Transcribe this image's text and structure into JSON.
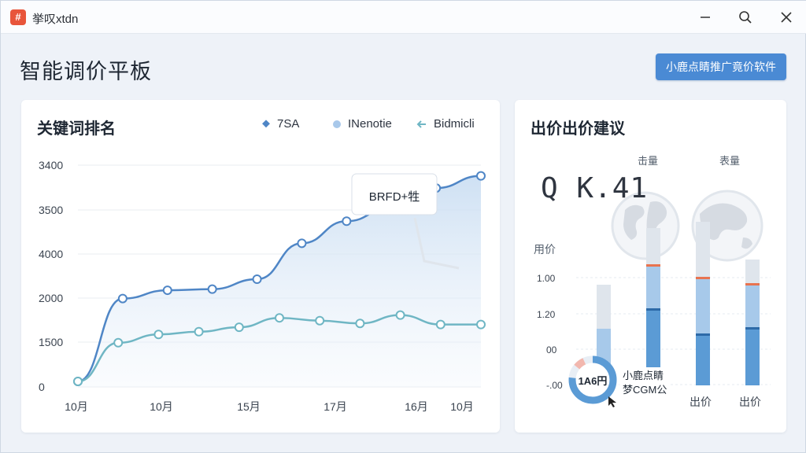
{
  "window": {
    "app_name": "挙叹xtdn",
    "app_icon_glyph": "#"
  },
  "header": {
    "title": "智能调价平板",
    "cta_label": "小鹿点睛推广竟价软件"
  },
  "left_card": {
    "title": "关键词排名",
    "legend": [
      {
        "label": "7SA",
        "color": "#4f86c6",
        "marker": "diamond"
      },
      {
        "label": "INenotie",
        "color": "#a8c8ea",
        "marker": "dot"
      },
      {
        "label": "Bidmicli",
        "color": "#6fb6c4",
        "marker": "arrow"
      }
    ],
    "tooltip": "BRFD+牲"
  },
  "chart_data": {
    "type": "line",
    "y_tick_labels": [
      "3400",
      "3500",
      "4000",
      "2000",
      "1500",
      "0"
    ],
    "x_tick_labels": [
      "10月",
      "10月",
      "15月",
      "17月",
      "16月",
      "10月"
    ],
    "series": [
      {
        "name": "7SA",
        "values": [
          0.1,
          1.6,
          1.75,
          1.77,
          1.95,
          2.6,
          3.0,
          3.25,
          3.6,
          3.82
        ],
        "color": "#4f86c6"
      },
      {
        "name": "Bidmicli",
        "values": [
          0.1,
          0.8,
          0.95,
          1.0,
          1.08,
          1.25,
          1.2,
          1.15,
          1.3,
          1.13,
          1.13
        ],
        "color": "#6fb6c4"
      }
    ],
    "grid": true,
    "area_fill": true
  },
  "right_card": {
    "title": "出价出价建议",
    "big_value": "Q K.41",
    "globe_labels": [
      "击量",
      "表量"
    ],
    "bar_section_label": "用价",
    "y_labels": [
      "1.00",
      "1.20",
      "00",
      "-.00"
    ],
    "x_labels": [
      "出价",
      "出价"
    ],
    "donut_value": "1A6円",
    "donut_tip_line1": "小鹿点睛",
    "donut_tip_line2": "梦CGM公"
  },
  "bar_chart": {
    "type": "bar",
    "bars": [
      {
        "total": 0.8,
        "mid": 0.45,
        "marker": null
      },
      {
        "total": 1.25,
        "mid": 0.95,
        "marker": 0.6
      },
      {
        "total": 1.3,
        "mid": 0.85,
        "marker": 0.4
      },
      {
        "total": 1.0,
        "mid": 0.8,
        "marker": 0.45
      }
    ]
  }
}
